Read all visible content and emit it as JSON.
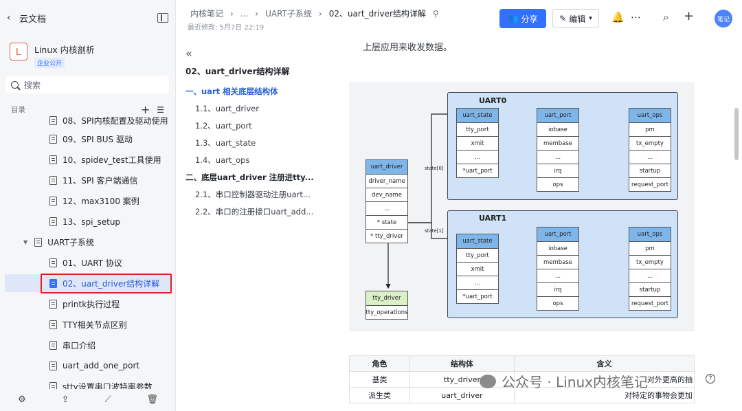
{
  "sidebar": {
    "back_label": "云文档",
    "space_logo": "L",
    "space_name": "Linux 内核剖析",
    "space_badge": "企业公开",
    "search_placeholder": "搜索",
    "toc_label": "目录",
    "items": [
      {
        "label": "08、SPI内核配置及驱动使用",
        "level": 2
      },
      {
        "label": "09、SPI BUS 驱动",
        "level": 2
      },
      {
        "label": "10、spidev_test工具使用",
        "level": 2
      },
      {
        "label": "11、SPI 客户端通信",
        "level": 2
      },
      {
        "label": "12、max3100 案例",
        "level": 2
      },
      {
        "label": "13、spi_setup",
        "level": 2
      },
      {
        "label": "UART子系统",
        "level": 1
      },
      {
        "label": "01、UART 协议",
        "level": 2
      },
      {
        "label": "02、uart_driver结构详解",
        "level": 2,
        "active": true
      },
      {
        "label": "printk执行过程",
        "level": 2
      },
      {
        "label": "TTY相关节点区别",
        "level": 2
      },
      {
        "label": "串口介绍",
        "level": 2
      },
      {
        "label": "uart_add_one_port",
        "level": 2
      },
      {
        "label": "stty设置串口波特率参数",
        "level": 2
      }
    ]
  },
  "header": {
    "crumbs": [
      "内核笔记",
      "...",
      "UART子系统",
      "02、uart_driver结构详解"
    ],
    "modified": "最近修改: 5月7日 22:19",
    "share_label": "分享",
    "edit_label": "编辑",
    "avatar_label": "笔记"
  },
  "outline": {
    "title": "02、uart_driver结构详解",
    "items": [
      {
        "label": "一、uart 相关底层结构体",
        "cls": "h1 active"
      },
      {
        "label": "1.1、uart_driver",
        "cls": "h2"
      },
      {
        "label": "1.2、uart_port",
        "cls": "h2"
      },
      {
        "label": "1.3、uart_state",
        "cls": "h2"
      },
      {
        "label": "1.4、uart_ops",
        "cls": "h2"
      },
      {
        "label": "二、底层uart_driver 注册进tty...",
        "cls": "h1"
      },
      {
        "label": "2.1、串口控制器驱动注册uart...",
        "cls": "h2"
      },
      {
        "label": "2.2、串口的注册接口uart_add...",
        "cls": "h2"
      }
    ]
  },
  "document": {
    "intro_text": "上层应用来收发数据。",
    "diagram": {
      "uart0_title": "UART0",
      "uart1_title": "UART1",
      "uart_driver": [
        "uart_driver",
        "driver_name",
        "dev_name",
        "...",
        "* state",
        "* tty_driver"
      ],
      "tty_driver": [
        "tty_driver",
        "tty_operations"
      ],
      "uart_state": [
        "uart_state",
        "tty_port",
        "xmit",
        "...",
        "*uart_port"
      ],
      "uart_port": [
        "uart_port",
        "iobase",
        "membase",
        "...",
        "irq",
        "ops"
      ],
      "uart_ops": [
        "uart_ops",
        "pm",
        "tx_empty",
        "...",
        "startup",
        "request_port"
      ],
      "edge_state0": "state[0]",
      "edge_state1": "state[1]"
    },
    "table": {
      "headers": [
        "角色",
        "结构体",
        "含义"
      ],
      "rows": [
        [
          "基类",
          "tty_driver",
          "对外更高的抽"
        ],
        [
          "派生类",
          "uart_driver",
          "对特定的事物会更加"
        ]
      ]
    }
  },
  "watermark": "公众号 · Linux内核笔记"
}
